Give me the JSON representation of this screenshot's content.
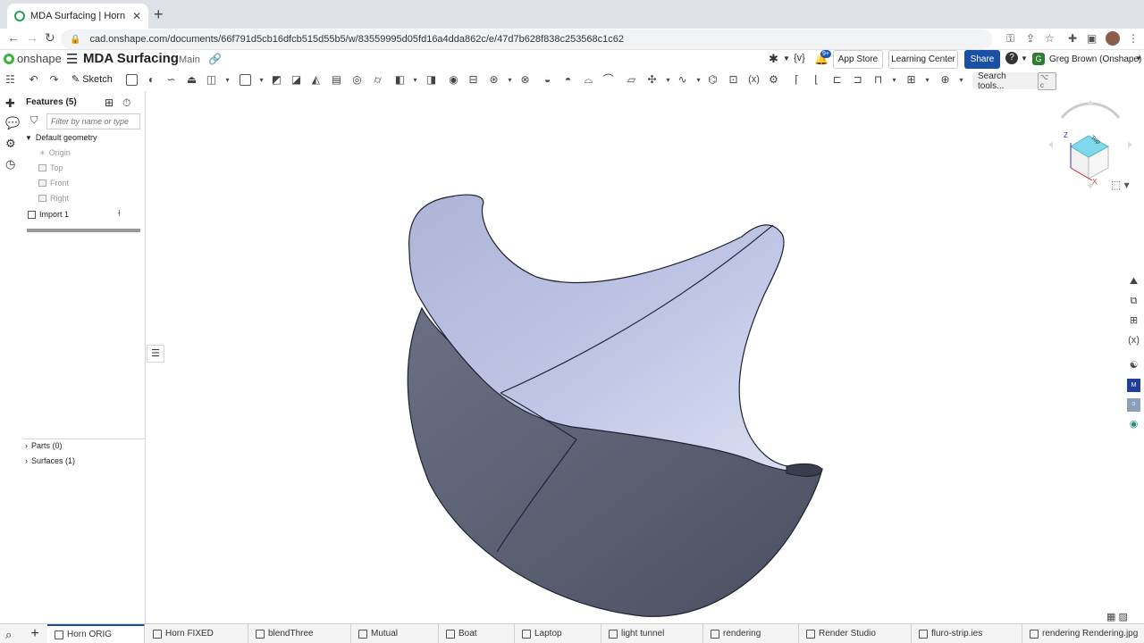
{
  "browser": {
    "tab_title": "MDA Surfacing | Horn ORIG",
    "tab_close": "✕",
    "new_tab": "+",
    "url": "cad.onshape.com/documents/66f791d5cb16dfcb515d55b5/w/83559995d05fd16a4dda862c/e/47d7b628f838c253568c1c62"
  },
  "header": {
    "logo_text": "onshape",
    "document_name": "MDA Surfacing",
    "branch": "Main",
    "notification_count": "9+",
    "app_store_label": "App Store",
    "learning_center_label": "Learning Center",
    "share_label": "Share",
    "help_glyph": "?",
    "user_initial": "G",
    "user_name": "Greg Brown (Onshape)"
  },
  "toolbar": {
    "sketch_label": "Sketch",
    "search_label": "Search tools...",
    "search_shortcut": "⌥ c"
  },
  "feature_panel": {
    "title": "Features (5)",
    "filter_placeholder": "Filter by name or type",
    "default_geometry_label": "Default geometry",
    "items": [
      {
        "label": "Origin"
      },
      {
        "label": "Top"
      },
      {
        "label": "Front"
      },
      {
        "label": "Right"
      }
    ],
    "import_label": "Import 1",
    "parts_label": "Parts (0)",
    "surfaces_label": "Surfaces (1)"
  },
  "view_cube": {
    "face_label": "Top",
    "axis_x": "X",
    "axis_z": "Z"
  },
  "bottom_tabs": [
    {
      "label": "Horn ORIG",
      "active": true
    },
    {
      "label": "Horn FIXED"
    },
    {
      "label": "blendThree"
    },
    {
      "label": "Mutual"
    },
    {
      "label": "Boat"
    },
    {
      "label": "Laptop"
    },
    {
      "label": "light tunnel"
    },
    {
      "label": "rendering"
    },
    {
      "label": "Render Studio"
    },
    {
      "label": "fluro-strip.ies"
    },
    {
      "label": "rendering Rendering.jpg"
    }
  ],
  "colors": {
    "brand_green": "#3cb43c",
    "share_blue": "#1a4fa3",
    "surface_light": "#b7bddf",
    "surface_dark": "#5d6275"
  }
}
